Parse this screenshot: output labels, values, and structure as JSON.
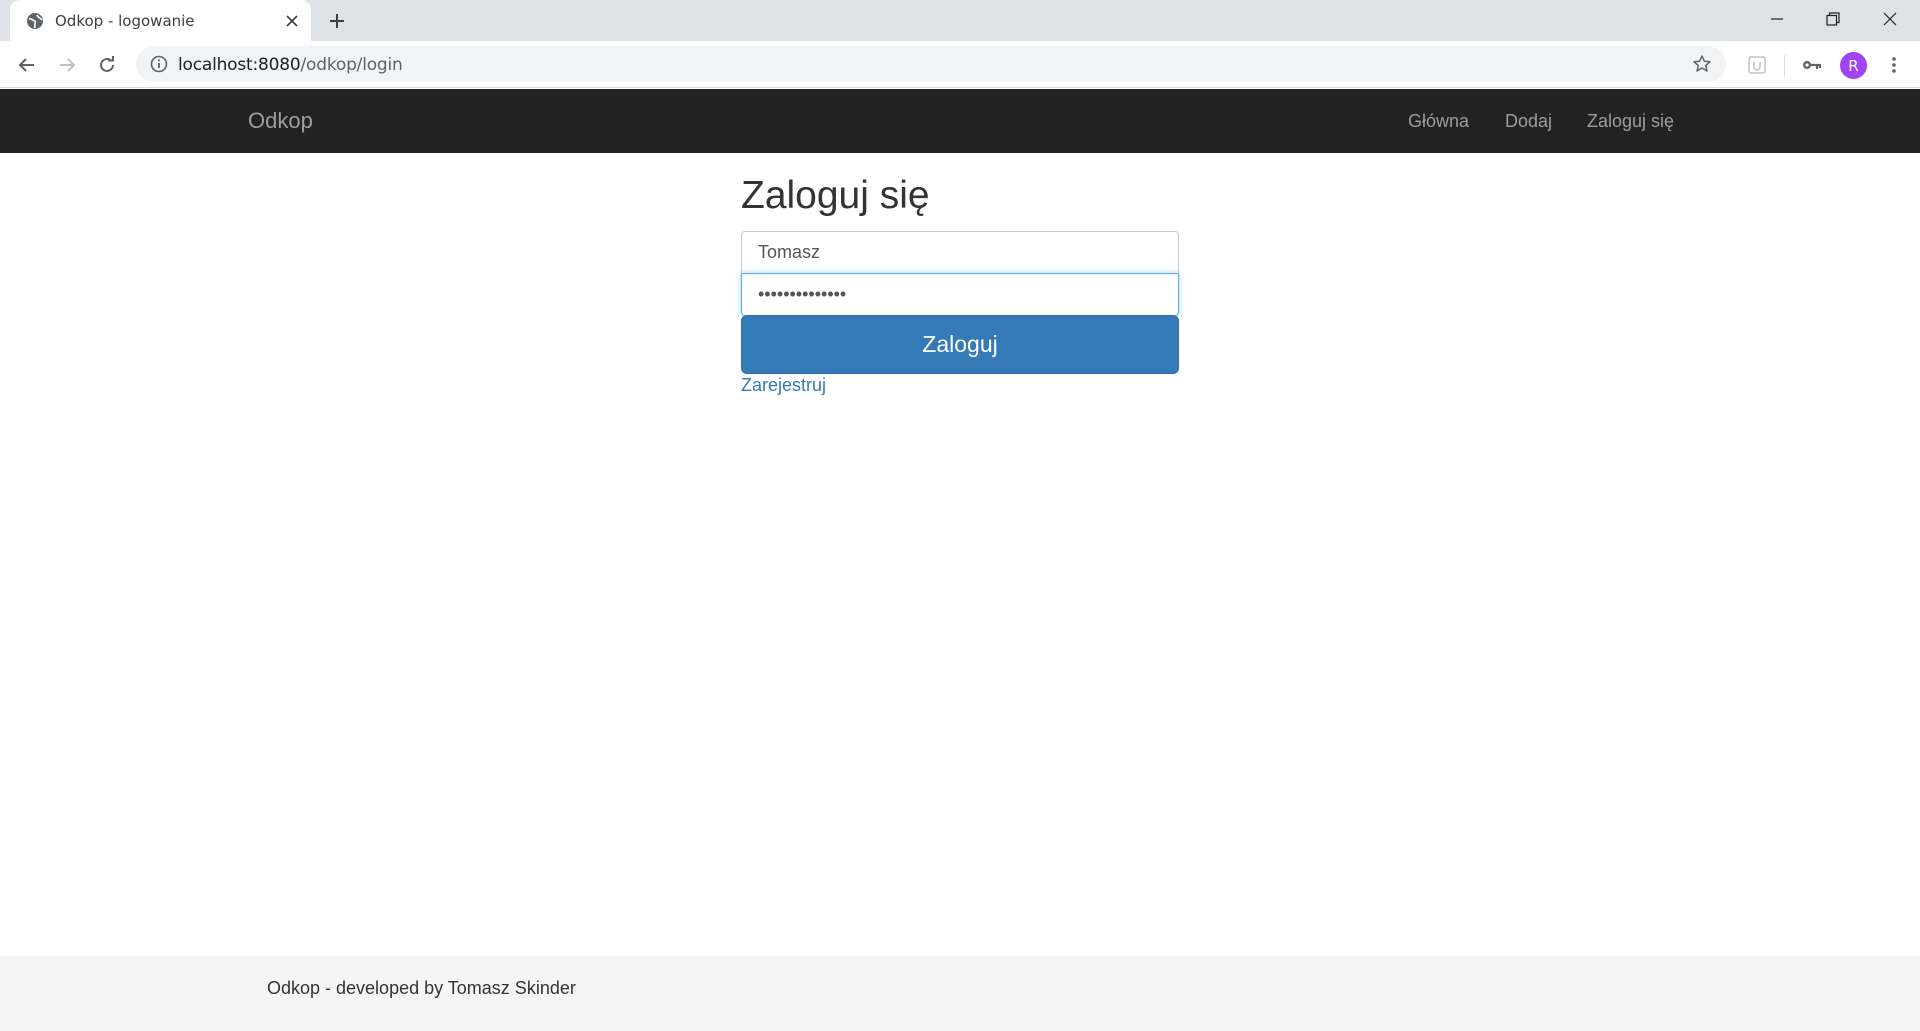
{
  "browser": {
    "tab_title": "Odkop - logowanie",
    "url_host": "localhost:8080",
    "url_path": "/odkop/login",
    "profile_initial": "R",
    "profile_color": "#a142f4"
  },
  "navbar": {
    "brand": "Odkop",
    "links": [
      "Główna",
      "Dodaj",
      "Zaloguj się"
    ],
    "bg_color": "#222222"
  },
  "login": {
    "heading": "Zaloguj się",
    "username_value": "Tomasz",
    "password_value": "••••••••••••••",
    "submit_label": "Zaloguj",
    "register_label": "Zarejestruj",
    "accent_color": "#337ab7"
  },
  "footer": {
    "text": "Odkop - developed by Tomasz Skinder"
  }
}
